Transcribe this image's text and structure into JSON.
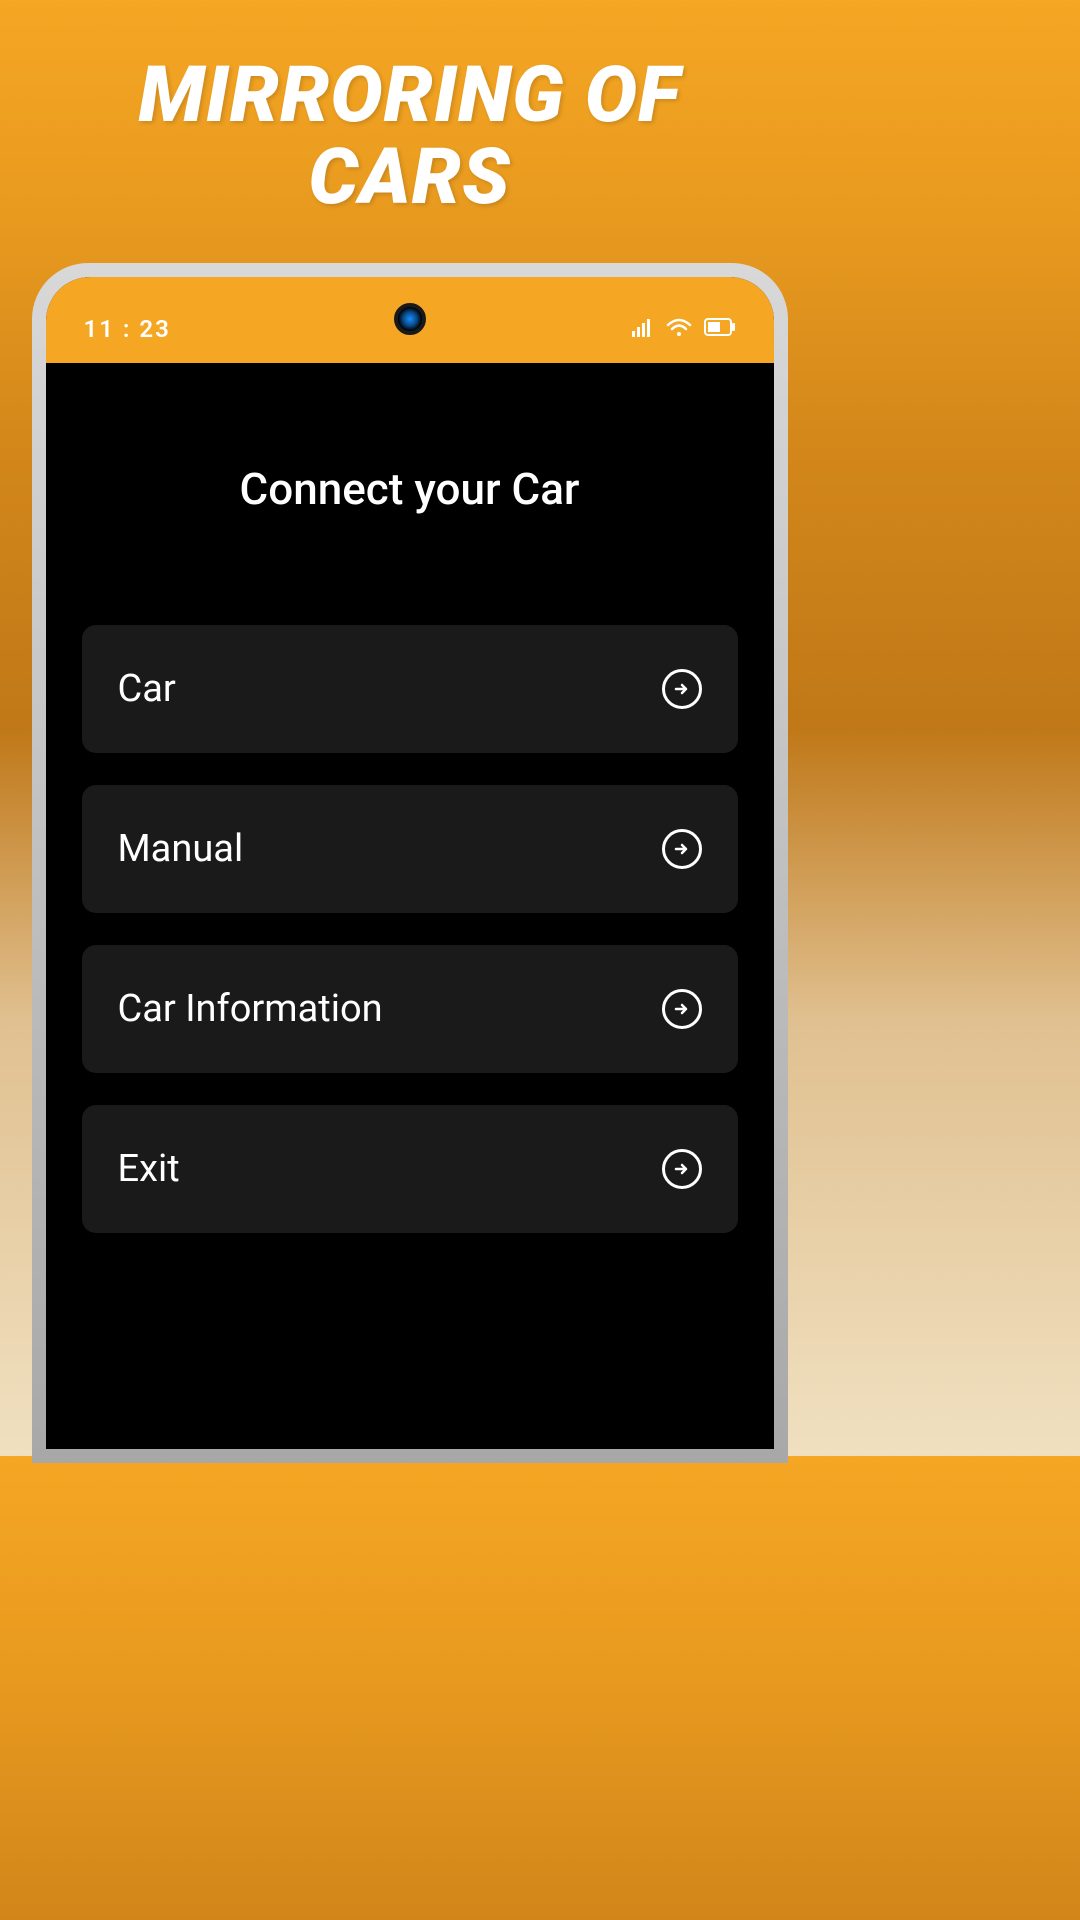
{
  "promo": {
    "title_line1": "MIRRORING OF",
    "title_line2": "CARS"
  },
  "statusbar": {
    "time": "11 : 23"
  },
  "app": {
    "title": "Connect your Car",
    "menu": [
      {
        "label": "Car"
      },
      {
        "label": "Manual"
      },
      {
        "label": "Car Information"
      },
      {
        "label": "Exit"
      }
    ]
  }
}
